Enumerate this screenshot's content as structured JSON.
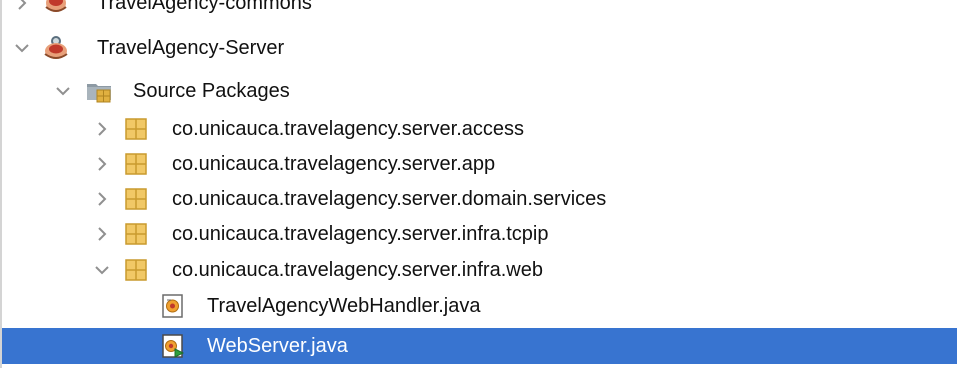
{
  "tree": {
    "rows": [
      {
        "label": "TravelAgency-commons",
        "expanded": false,
        "icon": "maven-project-icon"
      },
      {
        "label": "TravelAgency-Server",
        "expanded": true,
        "icon": "maven-web-project-icon"
      },
      {
        "label": "Source Packages",
        "expanded": true,
        "icon": "source-packages-folder-icon"
      },
      {
        "label": "co.unicauca.travelagency.server.access",
        "expanded": false,
        "icon": "package-icon"
      },
      {
        "label": "co.unicauca.travelagency.server.app",
        "expanded": false,
        "icon": "package-icon"
      },
      {
        "label": "co.unicauca.travelagency.server.domain.services",
        "expanded": false,
        "icon": "package-icon"
      },
      {
        "label": "co.unicauca.travelagency.server.infra.tcpip",
        "expanded": false,
        "icon": "package-icon"
      },
      {
        "label": "co.unicauca.travelagency.server.infra.web",
        "expanded": true,
        "icon": "package-icon"
      },
      {
        "label": "TravelAgencyWebHandler.java",
        "icon": "java-class-file-icon"
      },
      {
        "label": "WebServer.java",
        "icon": "java-main-class-file-icon",
        "selected": true
      }
    ]
  },
  "colors": {
    "selection": "#3874d0",
    "package": "#e0b040",
    "chevron": "#909090"
  }
}
